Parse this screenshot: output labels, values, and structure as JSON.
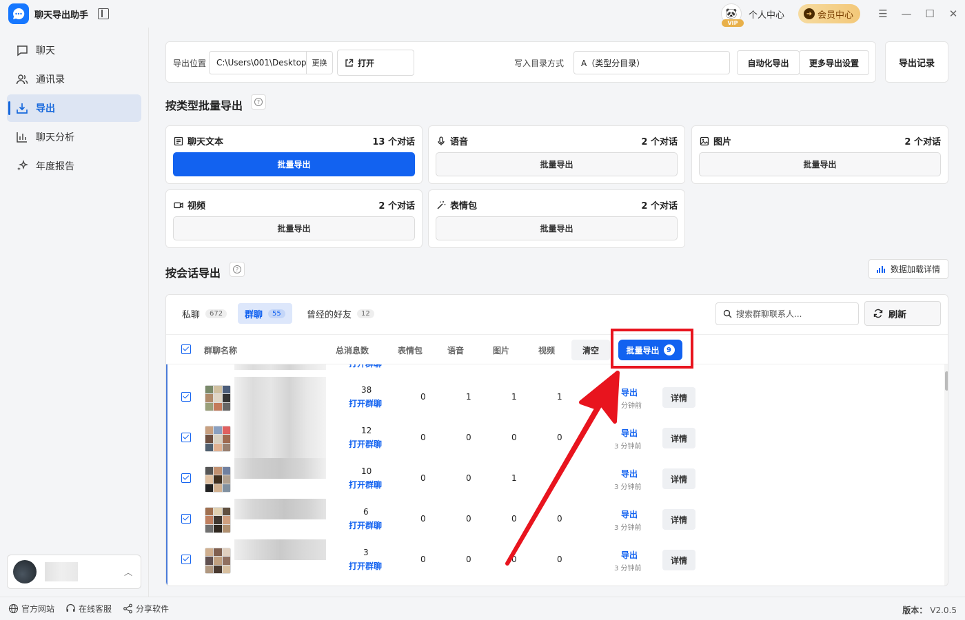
{
  "app": {
    "title": "聊天导出助手"
  },
  "titlebar": {
    "vip_badge": "VIP",
    "personal": "个人中心",
    "member": "会员中心"
  },
  "sidebar": {
    "items": [
      {
        "label": "聊天",
        "icon": "chat-icon"
      },
      {
        "label": "通讯录",
        "icon": "contacts-icon"
      },
      {
        "label": "导出",
        "icon": "export-icon",
        "active": true
      },
      {
        "label": "聊天分析",
        "icon": "bar-chart-icon"
      },
      {
        "label": "年度报告",
        "icon": "sparkle-icon"
      }
    ]
  },
  "footer": {
    "website": "官方网站",
    "support": "在线客服",
    "share": "分享软件",
    "version_label": "版本：",
    "version": "V2.0.5"
  },
  "export_settings": {
    "location_label": "导出位置",
    "path": "C:\\Users\\001\\Desktop",
    "change": "更换",
    "open": "打开",
    "dir_mode_label": "写入目录方式",
    "dir_mode": "A（类型分目录）",
    "auto_export": "自动化导出",
    "more_settings": "更多导出设置",
    "records": "导出记录"
  },
  "by_type": {
    "title": "按类型批量导出",
    "button": "批量导出",
    "cards": [
      {
        "name": "聊天文本",
        "count": "13 个对话",
        "primary": true
      },
      {
        "name": "语音",
        "count": "2 个对话"
      },
      {
        "name": "图片",
        "count": "2 个对话"
      },
      {
        "name": "视频",
        "count": "2 个对话"
      },
      {
        "name": "表情包",
        "count": "2 个对话"
      }
    ]
  },
  "by_session": {
    "title": "按会话导出",
    "data_detail": "数据加载详情",
    "tabs": [
      {
        "label": "私聊",
        "count": "672"
      },
      {
        "label": "群聊",
        "count": "55",
        "active": true
      },
      {
        "label": "曾经的好友",
        "count": "12"
      }
    ],
    "search_placeholder": "搜索群聊联系人...",
    "refresh": "刷新",
    "columns": {
      "name": "群聊名称",
      "total": "总消息数",
      "sticker": "表情包",
      "voice": "语音",
      "image": "图片",
      "video": "视频"
    },
    "clear": "清空",
    "batch_export": "批量导出",
    "batch_count": "9",
    "open_group": "打开群聊",
    "export": "导出",
    "detail": "详情",
    "rows": [
      {
        "total": "38",
        "sticker": "0",
        "voice": "1",
        "image": "1",
        "video": "1",
        "ago": "分钟前"
      },
      {
        "total": "12",
        "sticker": "0",
        "voice": "0",
        "image": "0",
        "video": "0",
        "ago": "3 分钟前"
      },
      {
        "total": "10",
        "sticker": "0",
        "voice": "0",
        "image": "1",
        "video": "",
        "ago": "3 分钟前"
      },
      {
        "total": "6",
        "sticker": "0",
        "voice": "0",
        "image": "0",
        "video": "0",
        "ago": "3 分钟前"
      },
      {
        "total": "3",
        "sticker": "0",
        "voice": "0",
        "image": "0",
        "video": "0",
        "ago": "3 分钟前"
      }
    ]
  },
  "colors": {
    "primary": "#1262f0",
    "annotation": "#e8141e",
    "member_gold": "#f3c879"
  }
}
